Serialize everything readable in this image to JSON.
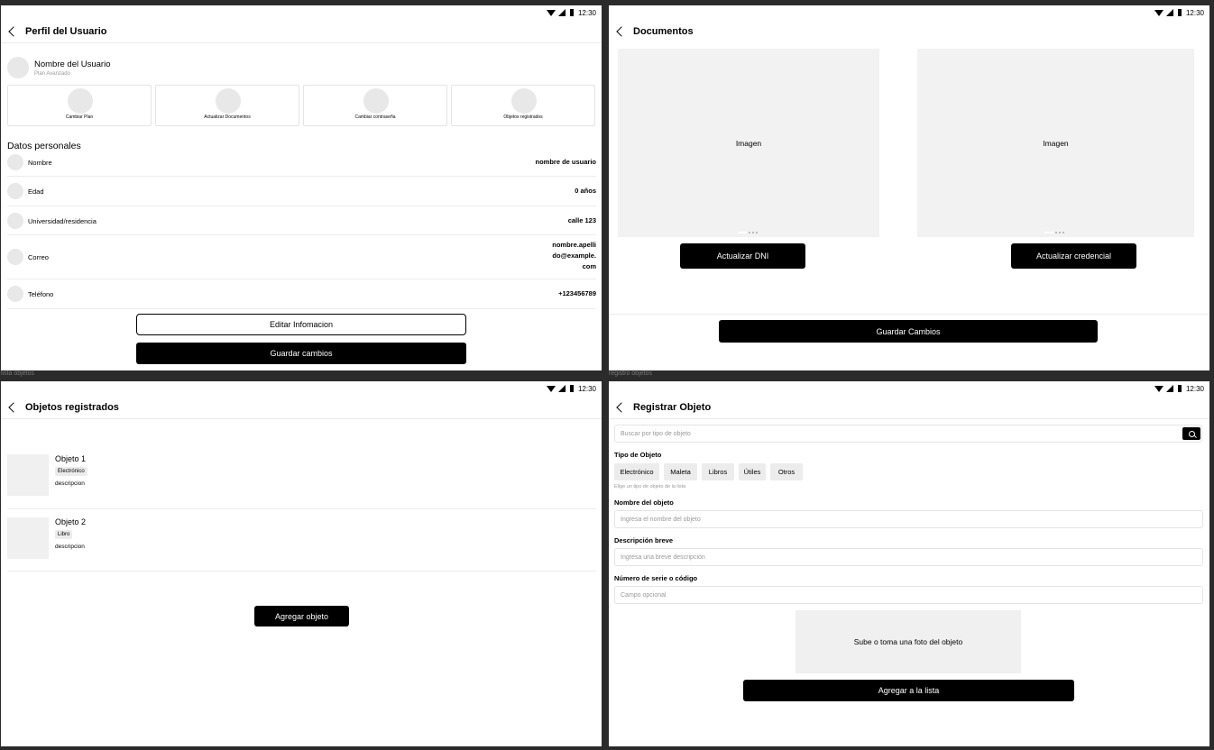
{
  "status": {
    "time": "12:30"
  },
  "frame_labels": {
    "list": "lista objetos",
    "register": "registro objetos"
  },
  "profile": {
    "title": "Perfil del Usuario",
    "user_name": "Nombre del Usuario",
    "plan": "Plan Avanzado",
    "actions": [
      "Cambiar Plan",
      "Actualizar Documentos",
      "Cambiar contraseña",
      "Objetos registrados"
    ],
    "section_title": "Datos personales",
    "fields": [
      {
        "label": "Nombre",
        "value": "nombre de usuario"
      },
      {
        "label": "Edad",
        "value": "0 años"
      },
      {
        "label": "Universidad/residencia",
        "value": "calle 123"
      },
      {
        "label": "Correo",
        "value": "nombre.apelli\ndo@example.\ncom"
      },
      {
        "label": "Teléfono",
        "value": "+123456789"
      }
    ],
    "edit_button": "Editar Infomacion",
    "save_button": "Guardar cambios"
  },
  "documents": {
    "title": "Documentos",
    "images": [
      "Imagen",
      "Imagen"
    ],
    "update_dni": "Actualizar DNI",
    "update_credential": "Actualizar credencial",
    "save_button": "Guardar Cambios"
  },
  "objects": {
    "title": "Objetos registrados",
    "items": [
      {
        "name": "Objeto 1",
        "tag": "Electrónico",
        "desc": "descripcion"
      },
      {
        "name": "Objeto 2",
        "tag": "Libro",
        "desc": "descripcion"
      }
    ],
    "add_button": "Agregar objeto"
  },
  "register": {
    "title": "Registrar Objeto",
    "search_placeholder": "Buscar por tipo de objeto",
    "type_label": "Tipo de Objeto",
    "types": [
      "Electrónico",
      "Maleta",
      "Libros",
      "Útiles",
      "Otros"
    ],
    "type_hint": "Elige un tipo de objeto de la lista",
    "name_label": "Nombre del objeto",
    "name_placeholder": "Ingresa el nombre del objeto",
    "desc_label": "Descripción breve",
    "desc_placeholder": "Ingresa una breve descripción",
    "serial_label": "Número de serie o código",
    "serial_placeholder": "Campo opcional",
    "upload_label": "Sube o toma una foto del objeto",
    "add_button": "Agregar a la lista"
  }
}
